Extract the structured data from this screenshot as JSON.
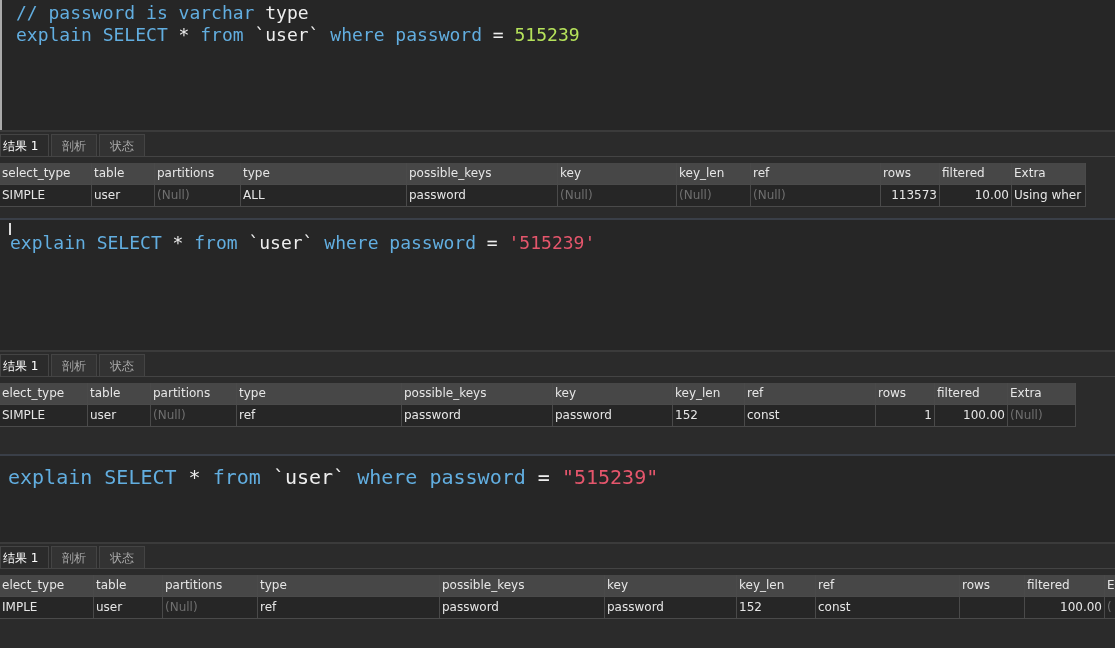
{
  "panels": [
    {
      "code_lines": [
        [
          {
            "kind": "comment",
            "text": "// password is varchar"
          },
          {
            "kind": "plain",
            "text": " type"
          }
        ],
        [
          {
            "kind": "keyword",
            "text": "explain SELECT"
          },
          {
            "kind": "plain",
            "text": " * "
          },
          {
            "kind": "keyword",
            "text": "from"
          },
          {
            "kind": "plain",
            "text": " `user` "
          },
          {
            "kind": "keyword",
            "text": "where password"
          },
          {
            "kind": "plain",
            "text": " = "
          },
          {
            "kind": "number",
            "text": "515239"
          }
        ]
      ],
      "tabs": [
        {
          "label": "结果 1",
          "selected": true
        },
        {
          "label": "剖析",
          "selected": false
        },
        {
          "label": "状态",
          "selected": false
        }
      ],
      "columns": [
        "select_type",
        "table",
        "partitions",
        "type",
        "possible_keys",
        "key",
        "key_len",
        "ref",
        "rows",
        "filtered",
        "Extra"
      ],
      "rows": [
        [
          {
            "kind": "text",
            "text": "SIMPLE"
          },
          {
            "kind": "text",
            "text": "user"
          },
          {
            "kind": "null",
            "text": "(Null)"
          },
          {
            "kind": "text",
            "text": "ALL"
          },
          {
            "kind": "text",
            "text": "password"
          },
          {
            "kind": "null",
            "text": "(Null)"
          },
          {
            "kind": "null",
            "text": "(Null)"
          },
          {
            "kind": "null",
            "text": "(Null)"
          },
          {
            "kind": "number",
            "text": "113573"
          },
          {
            "kind": "number",
            "text": "10.00"
          },
          {
            "kind": "text",
            "text": "Using wher"
          }
        ]
      ]
    },
    {
      "code_lines": [
        [
          {
            "kind": "keyword",
            "text": "explain SELECT"
          },
          {
            "kind": "plain",
            "text": " * "
          },
          {
            "kind": "keyword",
            "text": "from"
          },
          {
            "kind": "plain",
            "text": " `user` "
          },
          {
            "kind": "keyword",
            "text": "where password"
          },
          {
            "kind": "plain",
            "text": " = "
          },
          {
            "kind": "string",
            "text": "'515239'"
          }
        ]
      ],
      "cursor": true,
      "tabs": [
        {
          "label": "结果 1",
          "selected": true
        },
        {
          "label": "剖析",
          "selected": false
        },
        {
          "label": "状态",
          "selected": false
        }
      ],
      "columns": [
        "elect_type",
        "table",
        "partitions",
        "type",
        "possible_keys",
        "key",
        "key_len",
        "ref",
        "rows",
        "filtered",
        "Extra"
      ],
      "rows": [
        [
          {
            "kind": "text",
            "text": "SIMPLE"
          },
          {
            "kind": "text",
            "text": "user"
          },
          {
            "kind": "null",
            "text": "(Null)"
          },
          {
            "kind": "text",
            "text": "ref"
          },
          {
            "kind": "text",
            "text": "password"
          },
          {
            "kind": "text",
            "text": "password"
          },
          {
            "kind": "text",
            "text": "152"
          },
          {
            "kind": "text",
            "text": "const"
          },
          {
            "kind": "number",
            "text": "1"
          },
          {
            "kind": "number",
            "text": "100.00"
          },
          {
            "kind": "null",
            "text": "(Null)"
          }
        ]
      ]
    },
    {
      "code_lines": [
        [
          {
            "kind": "keyword",
            "text": "explain SELECT"
          },
          {
            "kind": "plain",
            "text": " * "
          },
          {
            "kind": "keyword",
            "text": "from"
          },
          {
            "kind": "plain",
            "text": " `user` "
          },
          {
            "kind": "keyword",
            "text": "where password"
          },
          {
            "kind": "plain",
            "text": " = "
          },
          {
            "kind": "string",
            "text": "\"515239\""
          }
        ]
      ],
      "tabs": [
        {
          "label": "结果 1",
          "selected": true
        },
        {
          "label": "剖析",
          "selected": false
        },
        {
          "label": "状态",
          "selected": false
        }
      ],
      "columns": [
        "elect_type",
        "table",
        "partitions",
        "type",
        "possible_keys",
        "key",
        "key_len",
        "ref",
        "rows",
        "filtered",
        "E"
      ],
      "rows": [
        [
          {
            "kind": "text",
            "text": "IMPLE"
          },
          {
            "kind": "text",
            "text": "user"
          },
          {
            "kind": "null",
            "text": "(Null)"
          },
          {
            "kind": "text",
            "text": "ref"
          },
          {
            "kind": "text",
            "text": "password"
          },
          {
            "kind": "text",
            "text": "password"
          },
          {
            "kind": "text",
            "text": "152"
          },
          {
            "kind": "text",
            "text": "const"
          },
          {
            "kind": "number"
          },
          {
            "kind": "number",
            "text": "100.00"
          },
          {
            "kind": "null",
            "text": "("
          }
        ]
      ]
    }
  ]
}
